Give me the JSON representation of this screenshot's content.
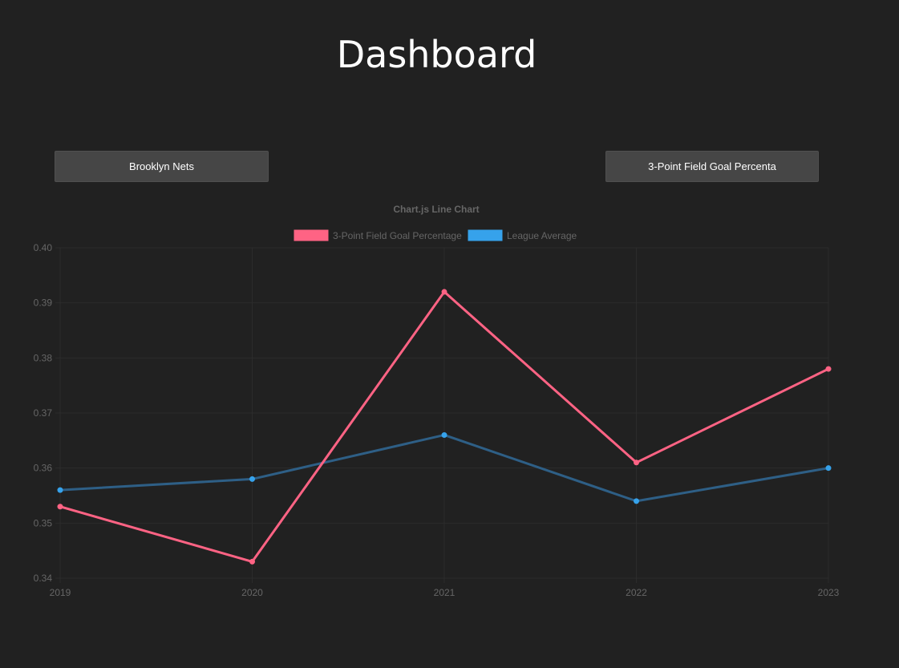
{
  "header": {
    "title": "Dashboard"
  },
  "controls": {
    "team_select": "Brooklyn Nets",
    "stat_select": "3-Point Field Goal Percenta"
  },
  "colors": {
    "background": "#212121",
    "grid": "#2c2c2c",
    "axis_text": "#666666",
    "series_team": "#ff6384",
    "series_league": "#36a2eb"
  },
  "chart_data": {
    "type": "line",
    "title": "Chart.js Line Chart",
    "xlabel": "",
    "ylabel": "",
    "x": [
      "2019",
      "2020",
      "2021",
      "2022",
      "2023"
    ],
    "ylim": [
      0.34,
      0.4
    ],
    "yticks": [
      "0.40",
      "0.39",
      "0.38",
      "0.37",
      "0.36",
      "0.35",
      "0.34"
    ],
    "grid": true,
    "legend_position": "top",
    "series": [
      {
        "name": "3-Point Field Goal Percentage",
        "color": "#ff6384",
        "values": [
          0.353,
          0.343,
          0.392,
          0.361,
          0.378
        ]
      },
      {
        "name": "League Average",
        "color": "#36a2eb",
        "values": [
          0.356,
          0.358,
          0.366,
          0.354,
          0.36
        ]
      }
    ]
  }
}
